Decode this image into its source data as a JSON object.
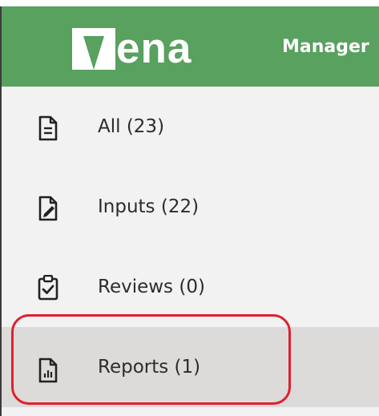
{
  "header": {
    "logo_text": "ena",
    "title": "Manager"
  },
  "colors": {
    "header_bg": "#58a15f",
    "active_item_bg": "#dcdbd9",
    "highlight": "#e0202e"
  },
  "sidebar": {
    "items": [
      {
        "label": "All (23)",
        "icon": "document-icon"
      },
      {
        "label": "Inputs (22)",
        "icon": "edit-document-icon"
      },
      {
        "label": "Reviews (0)",
        "icon": "clipboard-check-icon"
      },
      {
        "label": "Reports (1)",
        "icon": "report-document-icon",
        "active": true
      }
    ]
  }
}
